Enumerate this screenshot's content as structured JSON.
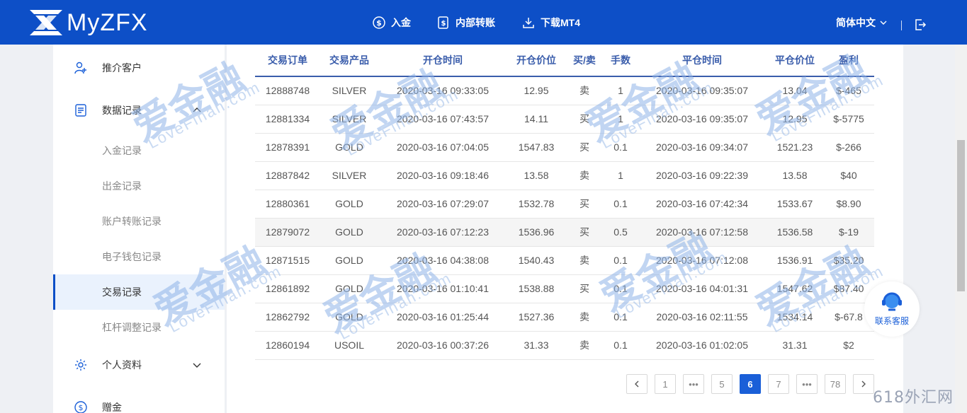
{
  "brand": {
    "name": "MyZFX"
  },
  "header": {
    "nav": [
      {
        "label": "入金",
        "icon": "dollar-circle-icon"
      },
      {
        "label": "内部转账",
        "icon": "transfer-icon"
      },
      {
        "label": "下载MT4",
        "icon": "download-icon"
      }
    ],
    "language": "简体中文",
    "logout_icon": "logout-icon"
  },
  "sidebar": {
    "items": [
      {
        "label": "推介客户",
        "icon": "user-plus-icon"
      },
      {
        "label": "数据记录",
        "icon": "document-icon"
      },
      {
        "label": "入金记录"
      },
      {
        "label": "出金记录"
      },
      {
        "label": "账户转账记录"
      },
      {
        "label": "电子钱包记录"
      },
      {
        "label": "交易记录"
      },
      {
        "label": "杠杆调整记录"
      },
      {
        "label": "个人资料",
        "icon": "gear-icon"
      },
      {
        "label": "赠金",
        "icon": "dollar-circle-icon"
      }
    ],
    "active": "交易记录"
  },
  "table": {
    "columns": [
      "交易订单",
      "交易产品",
      "开仓时间",
      "开仓价位",
      "买/卖",
      "手数",
      "平仓时间",
      "平仓价位",
      "盈利"
    ],
    "rows": [
      [
        "12888748",
        "SILVER",
        "2020-03-16 09:33:05",
        "12.95",
        "卖",
        "1",
        "2020-03-16 09:35:07",
        "13.04",
        "$-465"
      ],
      [
        "12881334",
        "SILVER",
        "2020-03-16 07:43:57",
        "14.11",
        "买",
        "1",
        "2020-03-16 09:35:07",
        "12.95",
        "$-5775"
      ],
      [
        "12878391",
        "GOLD",
        "2020-03-16 07:04:05",
        "1547.83",
        "买",
        "0.1",
        "2020-03-16 09:34:07",
        "1521.23",
        "$-266"
      ],
      [
        "12887842",
        "SILVER",
        "2020-03-16 09:18:46",
        "13.58",
        "卖",
        "1",
        "2020-03-16 09:22:39",
        "13.58",
        "$40"
      ],
      [
        "12880361",
        "GOLD",
        "2020-03-16 07:29:07",
        "1532.78",
        "买",
        "0.1",
        "2020-03-16 07:42:34",
        "1533.67",
        "$8.90"
      ],
      [
        "12879072",
        "GOLD",
        "2020-03-16 07:12:23",
        "1536.96",
        "买",
        "0.5",
        "2020-03-16 07:12:58",
        "1536.58",
        "$-19"
      ],
      [
        "12871515",
        "GOLD",
        "2020-03-16 04:38:08",
        "1540.43",
        "卖",
        "0.1",
        "2020-03-16 07:12:08",
        "1536.91",
        "$35.20"
      ],
      [
        "12861892",
        "GOLD",
        "2020-03-16 01:10:41",
        "1538.88",
        "买",
        "0.1",
        "2020-03-16 04:01:31",
        "1547.62",
        "$87.40"
      ],
      [
        "12862792",
        "GOLD",
        "2020-03-16 01:25:44",
        "1527.36",
        "卖",
        "0.1",
        "2020-03-16 02:11:55",
        "1534.14",
        "$-67.8"
      ],
      [
        "12860194",
        "USOIL",
        "2020-03-16 00:37:26",
        "31.33",
        "卖",
        "0.1",
        "2020-03-16 01:02:05",
        "31.31",
        "$2"
      ]
    ]
  },
  "pagination": {
    "prev_icon": "chevron-left-icon",
    "items": [
      "1",
      "•••",
      "5",
      "6",
      "7",
      "•••",
      "78"
    ],
    "current": "6",
    "next_icon": "chevron-right-icon"
  },
  "support": {
    "label": "联系客服",
    "icon": "headset-icon"
  },
  "watermark": {
    "main": "爱金融",
    "sub": "LoveFinan.com"
  },
  "corner_watermark": "618外汇网",
  "colors": {
    "header_bg": "#0d4fc7",
    "accent": "#1a5fd8",
    "table_header": "#3a5dab"
  }
}
